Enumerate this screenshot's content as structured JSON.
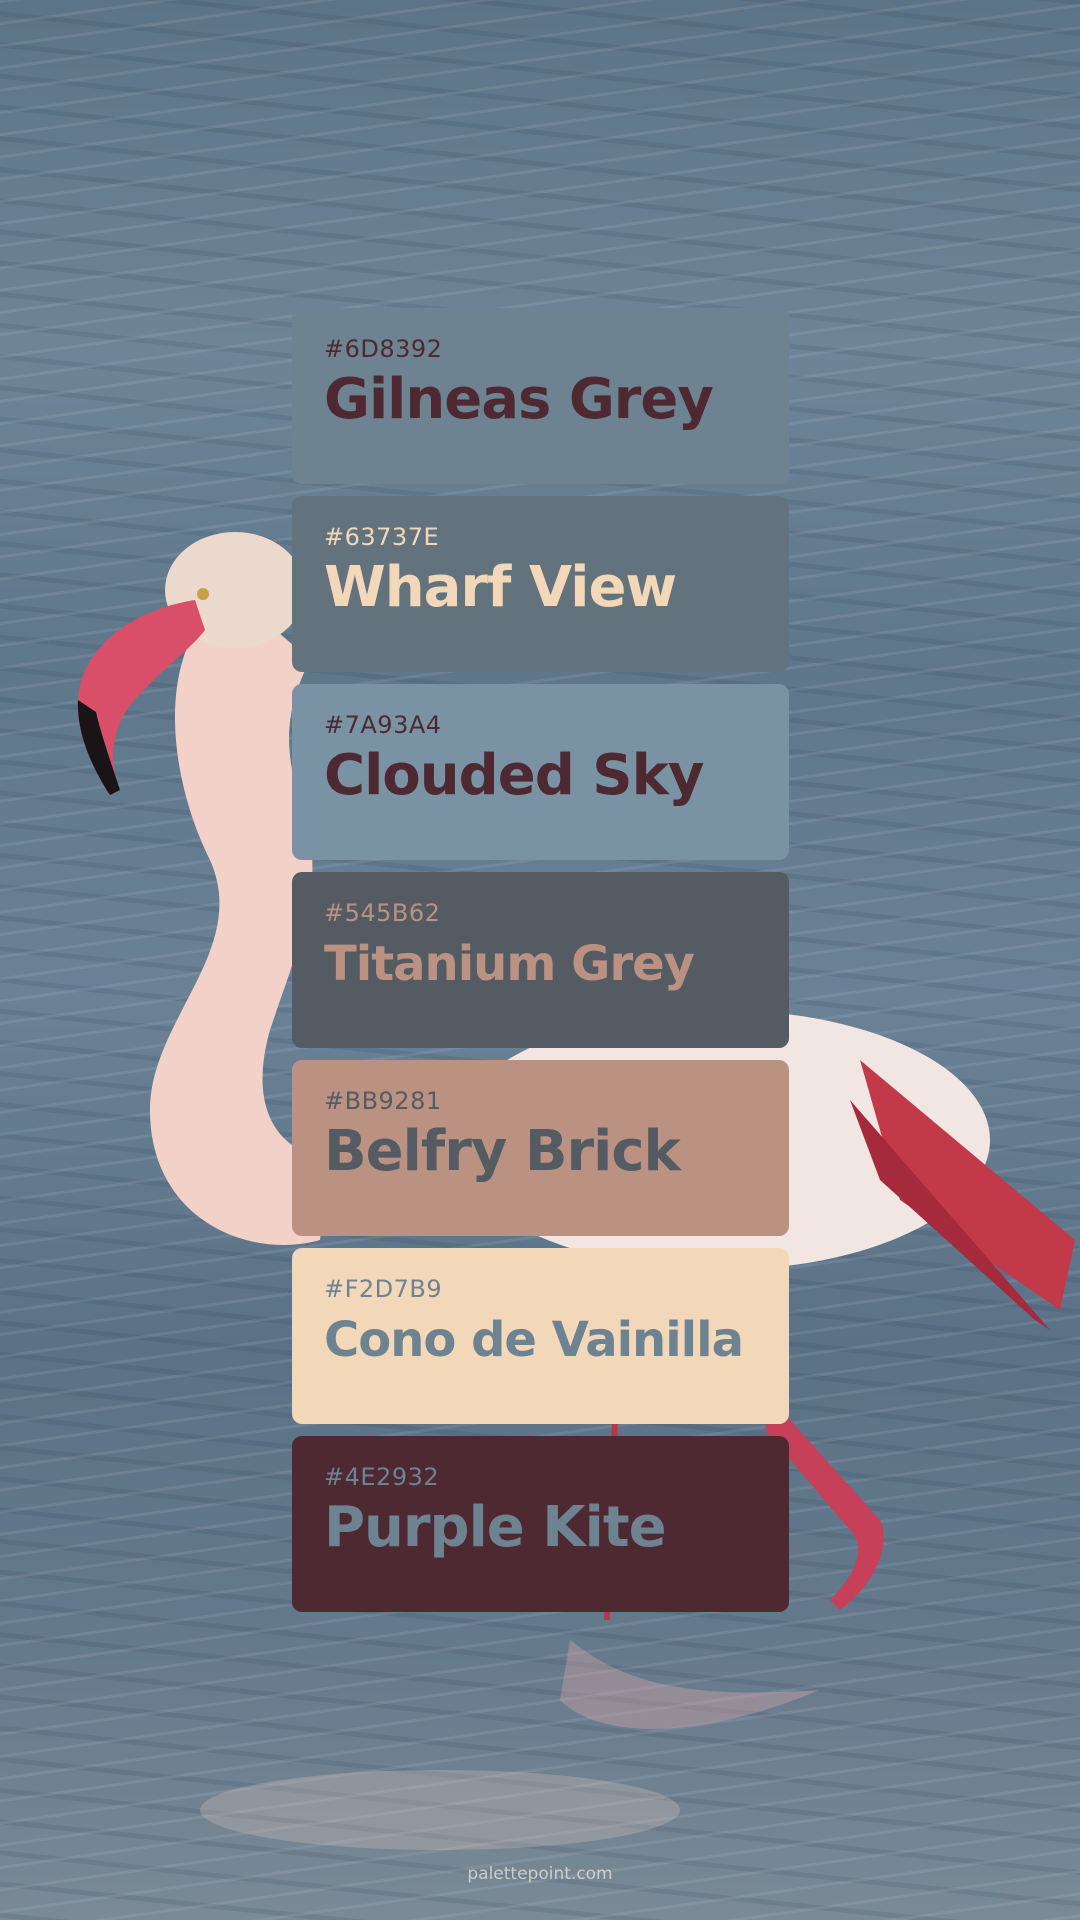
{
  "palette": {
    "swatches": [
      {
        "hex": "#6D8392",
        "name": "Gilneas Grey",
        "bg": "#6D8392",
        "fg": "#4E2932"
      },
      {
        "hex": "#63737E",
        "name": "Wharf View",
        "bg": "#63737E",
        "fg": "#F2D7B9"
      },
      {
        "hex": "#7A93A4",
        "name": "Clouded Sky",
        "bg": "#7A93A4",
        "fg": "#4E2932"
      },
      {
        "hex": "#545B62",
        "name": "Titanium Grey",
        "bg": "#545B62",
        "fg": "#BB9281"
      },
      {
        "hex": "#BB9281",
        "name": "Belfry Brick",
        "bg": "#BB9281",
        "fg": "#545B62"
      },
      {
        "hex": "#F2D7B9",
        "name": "Cono de Vainilla",
        "bg": "#F2D7B9",
        "fg": "#6D8392"
      },
      {
        "hex": "#4E2932",
        "name": "Purple Kite",
        "bg": "#4E2932",
        "fg": "#6D8392"
      }
    ]
  },
  "footer": {
    "credit": "palettepoint.com"
  }
}
